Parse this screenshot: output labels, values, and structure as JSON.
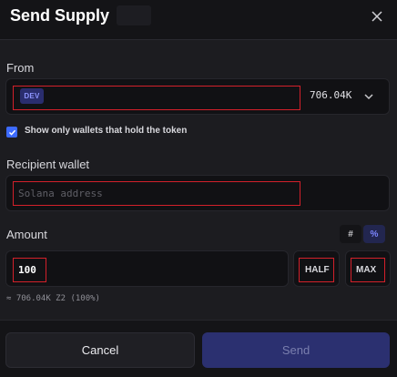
{
  "header": {
    "title": "Send Supply",
    "close_icon": "close-icon"
  },
  "from": {
    "label": "From",
    "token_badge": "DEV",
    "balance": "706.04K",
    "dropdown_icon": "chevron-down-icon"
  },
  "filter": {
    "checked": true,
    "label": "Show only wallets that hold the token"
  },
  "recipient": {
    "label": "Recipient wallet",
    "placeholder": "Solana address",
    "value": ""
  },
  "amount": {
    "label": "Amount",
    "mode_hash": "#",
    "mode_percent": "%",
    "active_mode": "%",
    "value": "100",
    "half_label": "HALF",
    "max_label": "MAX",
    "approx": "≈ 706.04K Z2 (100%)"
  },
  "footer": {
    "cancel_label": "Cancel",
    "send_label": "Send"
  },
  "colors": {
    "accent": "#3d6bff",
    "highlight_border": "#d3202a",
    "send_button": "#2b3070"
  }
}
